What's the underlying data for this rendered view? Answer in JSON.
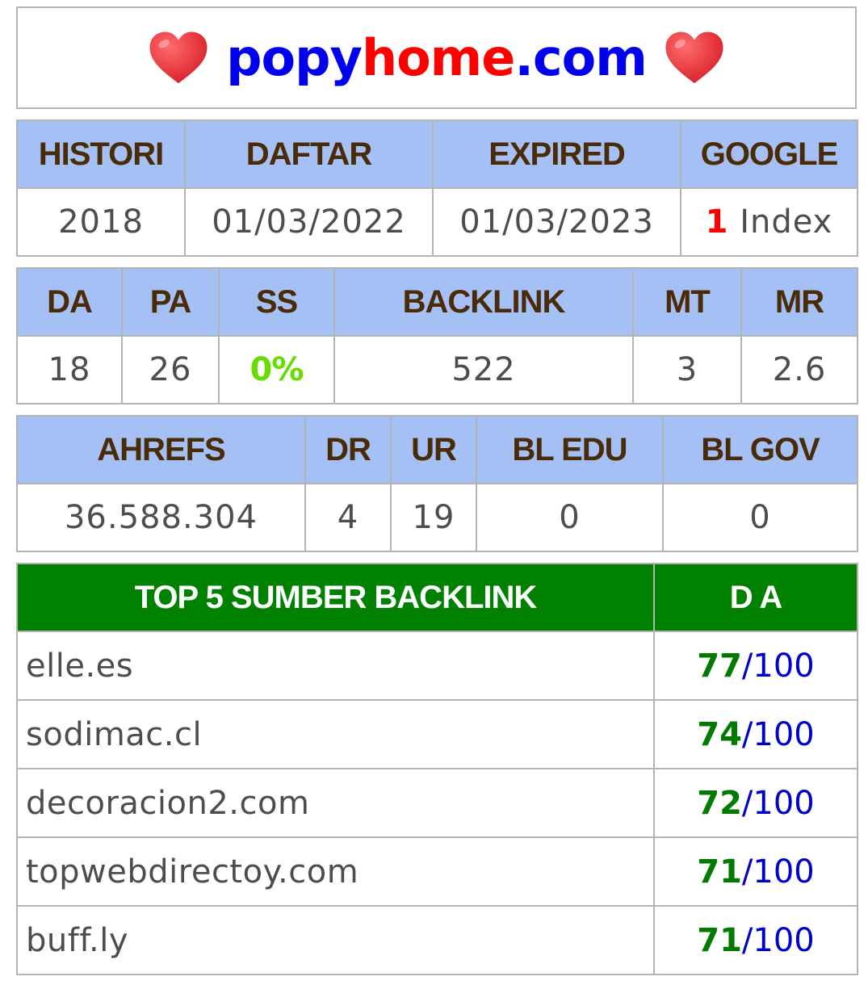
{
  "header": {
    "title_part1": "popy",
    "title_part2": "home",
    "title_part3": ".com",
    "heart_icon": "heart-icon",
    "colors": {
      "blue": "#0000ee",
      "red": "#ff0000",
      "heart": "#e8323c"
    }
  },
  "table1": {
    "headers": [
      "HISTORI",
      "DAFTAR",
      "EXPIRED",
      "GOOGLE"
    ],
    "values": {
      "histori": "2018",
      "daftar": "01/03/2022",
      "expired": "01/03/2023",
      "google_count": "1",
      "google_label": " Index"
    }
  },
  "table2": {
    "headers": [
      "DA",
      "PA",
      "SS",
      "BACKLINK",
      "MT",
      "MR"
    ],
    "values": [
      "18",
      "26",
      "0%",
      "522",
      "3",
      "2.6"
    ]
  },
  "table3": {
    "headers": [
      "AHREFS",
      "DR",
      "UR",
      "BL EDU",
      "BL GOV"
    ],
    "values": [
      "36.588.304",
      "4",
      "19",
      "0",
      "0"
    ]
  },
  "table4": {
    "headers": [
      "TOP 5 SUMBER BACKLINK",
      "D A"
    ],
    "rows": [
      {
        "site": "elle.es",
        "da": "77",
        "sep": "/",
        "max": "100"
      },
      {
        "site": "sodimac.cl",
        "da": "74",
        "sep": "/",
        "max": "100"
      },
      {
        "site": "decoracion2.com",
        "da": "72",
        "sep": "/",
        "max": "100"
      },
      {
        "site": "topwebdirectoy.com",
        "da": "71",
        "sep": "/",
        "max": "100"
      },
      {
        "site": "buff.ly",
        "da": "71",
        "sep": "/",
        "max": "100"
      }
    ]
  },
  "colors": {
    "header_bg": "#a4c0f5",
    "header_text": "#4a2b08",
    "green_header_bg": "#008200",
    "ss_green": "#66dd00",
    "da_green": "#007a00",
    "da_blue": "#0000cc"
  }
}
